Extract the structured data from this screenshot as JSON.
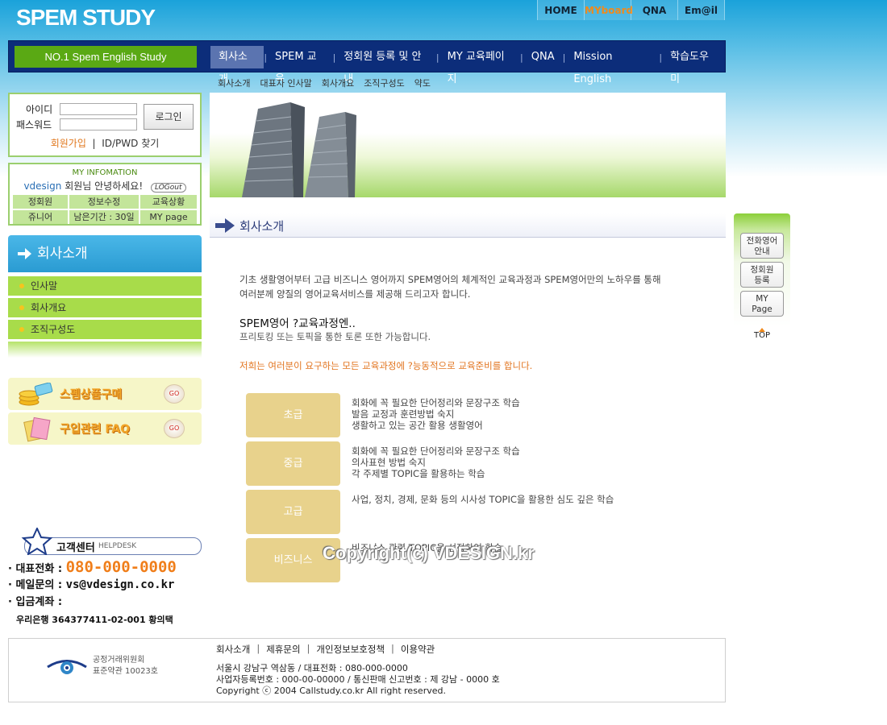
{
  "header": {
    "logo": "SPEM STUDY",
    "topnav": [
      "HOME",
      "MYboard",
      "QNA",
      "Em@il"
    ],
    "slogan": "NO.1 Spem English Study",
    "mainmenu": [
      "회사소개",
      "SPEM 교육",
      "정회원 등록 및 안내",
      "MY 교육페이지",
      "QNA",
      "Mission English",
      "학습도우미"
    ],
    "submenu": [
      "회사소개",
      "대표자 인사말",
      "회사개요",
      "조직구성도",
      "약도"
    ]
  },
  "login": {
    "id_label": "아이디",
    "pw_label": "패스워드",
    "button": "로그인",
    "join": "회원가입",
    "sep": "|",
    "find": "ID/PWD 찾기"
  },
  "myinfo": {
    "title": "MY INFOMATION",
    "user": "vdesign",
    "greeting": "회원님 안녕하세요!",
    "logout": "LOGout",
    "grid": [
      [
        "정회원",
        "정보수정",
        "교육상황"
      ],
      [
        "쥬니어",
        "남은기간 : 30일",
        "MY page"
      ]
    ]
  },
  "leftmenu": {
    "title": "회사소개",
    "items": [
      "인사말",
      "회사개요",
      "조직구성도"
    ]
  },
  "banners": [
    {
      "label": "스펨상품구매",
      "go": "GO"
    },
    {
      "label": "구입관련 FAQ",
      "go": "GO"
    }
  ],
  "helpdesk": {
    "title": "고객센터",
    "sub": "HELPDESK",
    "phone_label": "· 대표전화 :",
    "phone": "080-000-0000",
    "email_label": "· 메일문의 :",
    "email": "vs@vdesign.co.kr",
    "account_label": "· 입금계좌 :",
    "account": "우리은행 364377411-02-001 황의택"
  },
  "content": {
    "page_title": "회사소개",
    "intro": [
      "기초 생활영어부터 고급 비즈니스 영어까지 SPEM영어의 체계적인 교육과정과 SPEM영어만의 노하우를 통해",
      "여러분께 양질의 영어교육서비스를 제공해 드리고자 합니다."
    ],
    "subhead": "SPEM영어 ?교육과정엔..",
    "subtext": "프리토킹 또는 토픽을 통한 토론 또한 가능합니다.",
    "orange": "저희는 여러분이 요구하는 모든 교육과정에 ?능동적으로 교육준비를 합니다.",
    "courses": [
      {
        "level": "초급",
        "desc": [
          "회화에 꼭 필요한 단어정리와 문장구조 학습",
          "발음 교정과 훈련방법 숙지",
          "생활하고 있는 공간 활용 생활영어"
        ]
      },
      {
        "level": "중급",
        "desc": [
          "회화에 꼭 필요한 단어정리와 문장구조 학습",
          "의사표현 방법 숙지",
          "각 주제별 TOPIC을 활용하는 학습"
        ]
      },
      {
        "level": "고급",
        "desc": [
          "사업, 정치, 경제, 문화 등의 시사성 TOPIC을 활용한 심도 깊은 학습"
        ]
      },
      {
        "level": "비즈니스",
        "desc": [
          "비즈니스 관련 TOPIC을 선정하여 학습"
        ]
      }
    ],
    "watermark": "Copyright(c) VDESIGN.kr"
  },
  "quick": {
    "buttons": [
      [
        "전화영어",
        "안내"
      ],
      [
        "정회원",
        "등록"
      ],
      [
        "MY",
        "Page"
      ]
    ],
    "top": "TOP"
  },
  "footer": {
    "ftc": [
      "공정거래위원회",
      "표준약관 10023호"
    ],
    "links": [
      "회사소개",
      "제휴문의",
      "개인정보보호정책",
      "이용약관"
    ],
    "address": [
      "서울시 강남구 역삼동 / 대표전화 : 080-000-0000",
      "사업자등록번호 : 000-00-00000 / 통신판매 신고번호 : 제 강남 - 0000 호",
      "Copyright ⓒ 2004 Callstudy.co.kr All right reserved."
    ]
  }
}
